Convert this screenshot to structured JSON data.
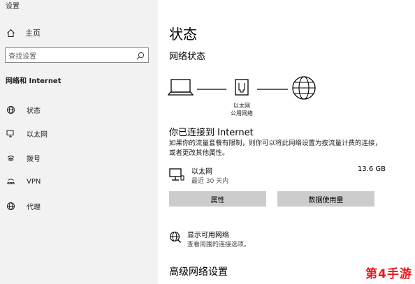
{
  "app_title": "设置",
  "sidebar": {
    "home_label": "主页",
    "search_placeholder": "查找设置",
    "section_title": "网络和 Internet",
    "items": [
      {
        "label": "状态",
        "icon": "globe-network-icon"
      },
      {
        "label": "以太网",
        "icon": "ethernet-monitor-icon"
      },
      {
        "label": "拨号",
        "icon": "dialup-phone-icon"
      },
      {
        "label": "VPN",
        "icon": "vpn-icon"
      },
      {
        "label": "代理",
        "icon": "globe-icon"
      }
    ]
  },
  "main": {
    "title": "状态",
    "network_status_heading": "网络状态",
    "diagram": {
      "ethernet_label_line1": "以太网",
      "ethernet_label_line2": "公用网络"
    },
    "connected_title": "你已连接到 Internet",
    "connected_desc": "如果你的流量套餐有限制，则你可以将此网络设置为按流量计费的连接，或者更改其他属性。",
    "connection": {
      "name": "以太网",
      "sub": "最近 30 天内",
      "size": "13.6 GB"
    },
    "buttons": {
      "properties": "属性",
      "data_usage": "数据使用量"
    },
    "available": {
      "title": "显示可用网络",
      "sub": "查看周围的连接选项。"
    },
    "advanced_heading": "高级网络设置"
  },
  "watermark": "第4手游",
  "colors": {
    "sidebar_bg": "#f2f2f2",
    "button_bg": "#cccccc",
    "watermark": "#e81919"
  }
}
